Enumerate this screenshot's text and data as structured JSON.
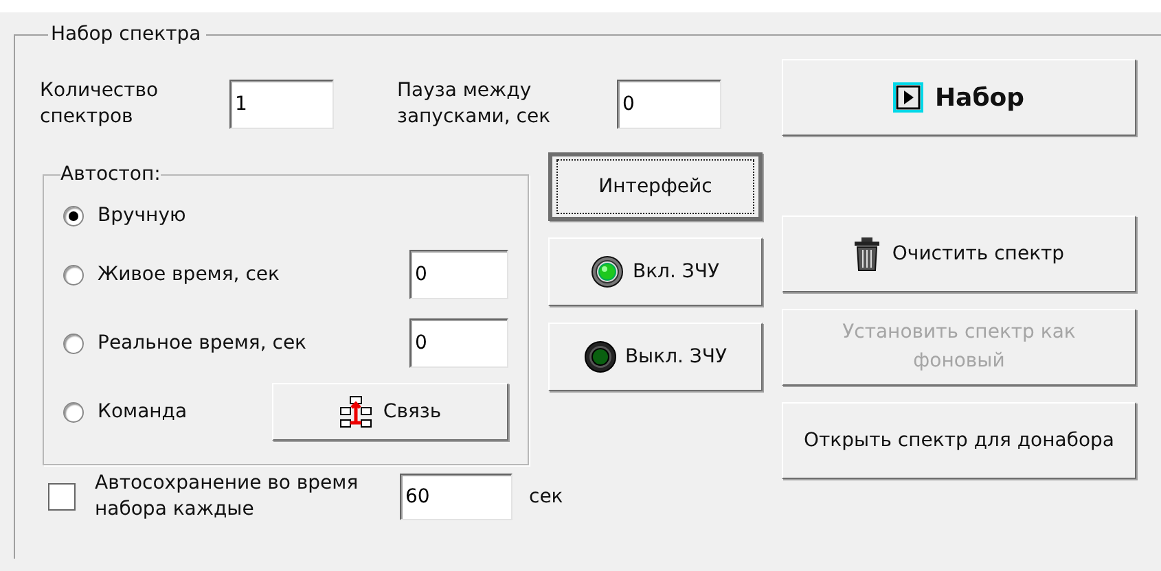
{
  "group_title": "Набор спектра",
  "count": {
    "label": "Количество спектров",
    "value": "1"
  },
  "pause": {
    "label": "Пауза  между запусками, сек",
    "value": "0"
  },
  "start_button": {
    "label": "Набор"
  },
  "autostop": {
    "title": "Автостоп:",
    "options": [
      {
        "label": "Вручную",
        "selected": true
      },
      {
        "label": "Живое время, сек",
        "selected": false,
        "value": "0"
      },
      {
        "label": "Реальное время, сек",
        "selected": false,
        "value": "0"
      },
      {
        "label": "Команда",
        "selected": false,
        "button": "Связь"
      }
    ]
  },
  "device_buttons": [
    {
      "kind": "plain",
      "label": "Интерфейс",
      "focused": true
    },
    {
      "kind": "led_on",
      "label": "Вкл. ЗЧУ",
      "focused": false
    },
    {
      "kind": "led_off",
      "label": "Выкл. ЗЧУ",
      "focused": false
    }
  ],
  "spectrum_buttons": [
    {
      "kind": "trash",
      "label": "Очистить спектр",
      "disabled": false
    },
    {
      "kind": "plain",
      "label": "Установить спектр как фоновый",
      "disabled": true
    },
    {
      "kind": "plain",
      "label": "Открыть спектр для донабора",
      "disabled": false
    }
  ],
  "autosave": {
    "checked": false,
    "label": "Автосохранение во время набора каждые",
    "value": "60",
    "unit": "сек"
  }
}
